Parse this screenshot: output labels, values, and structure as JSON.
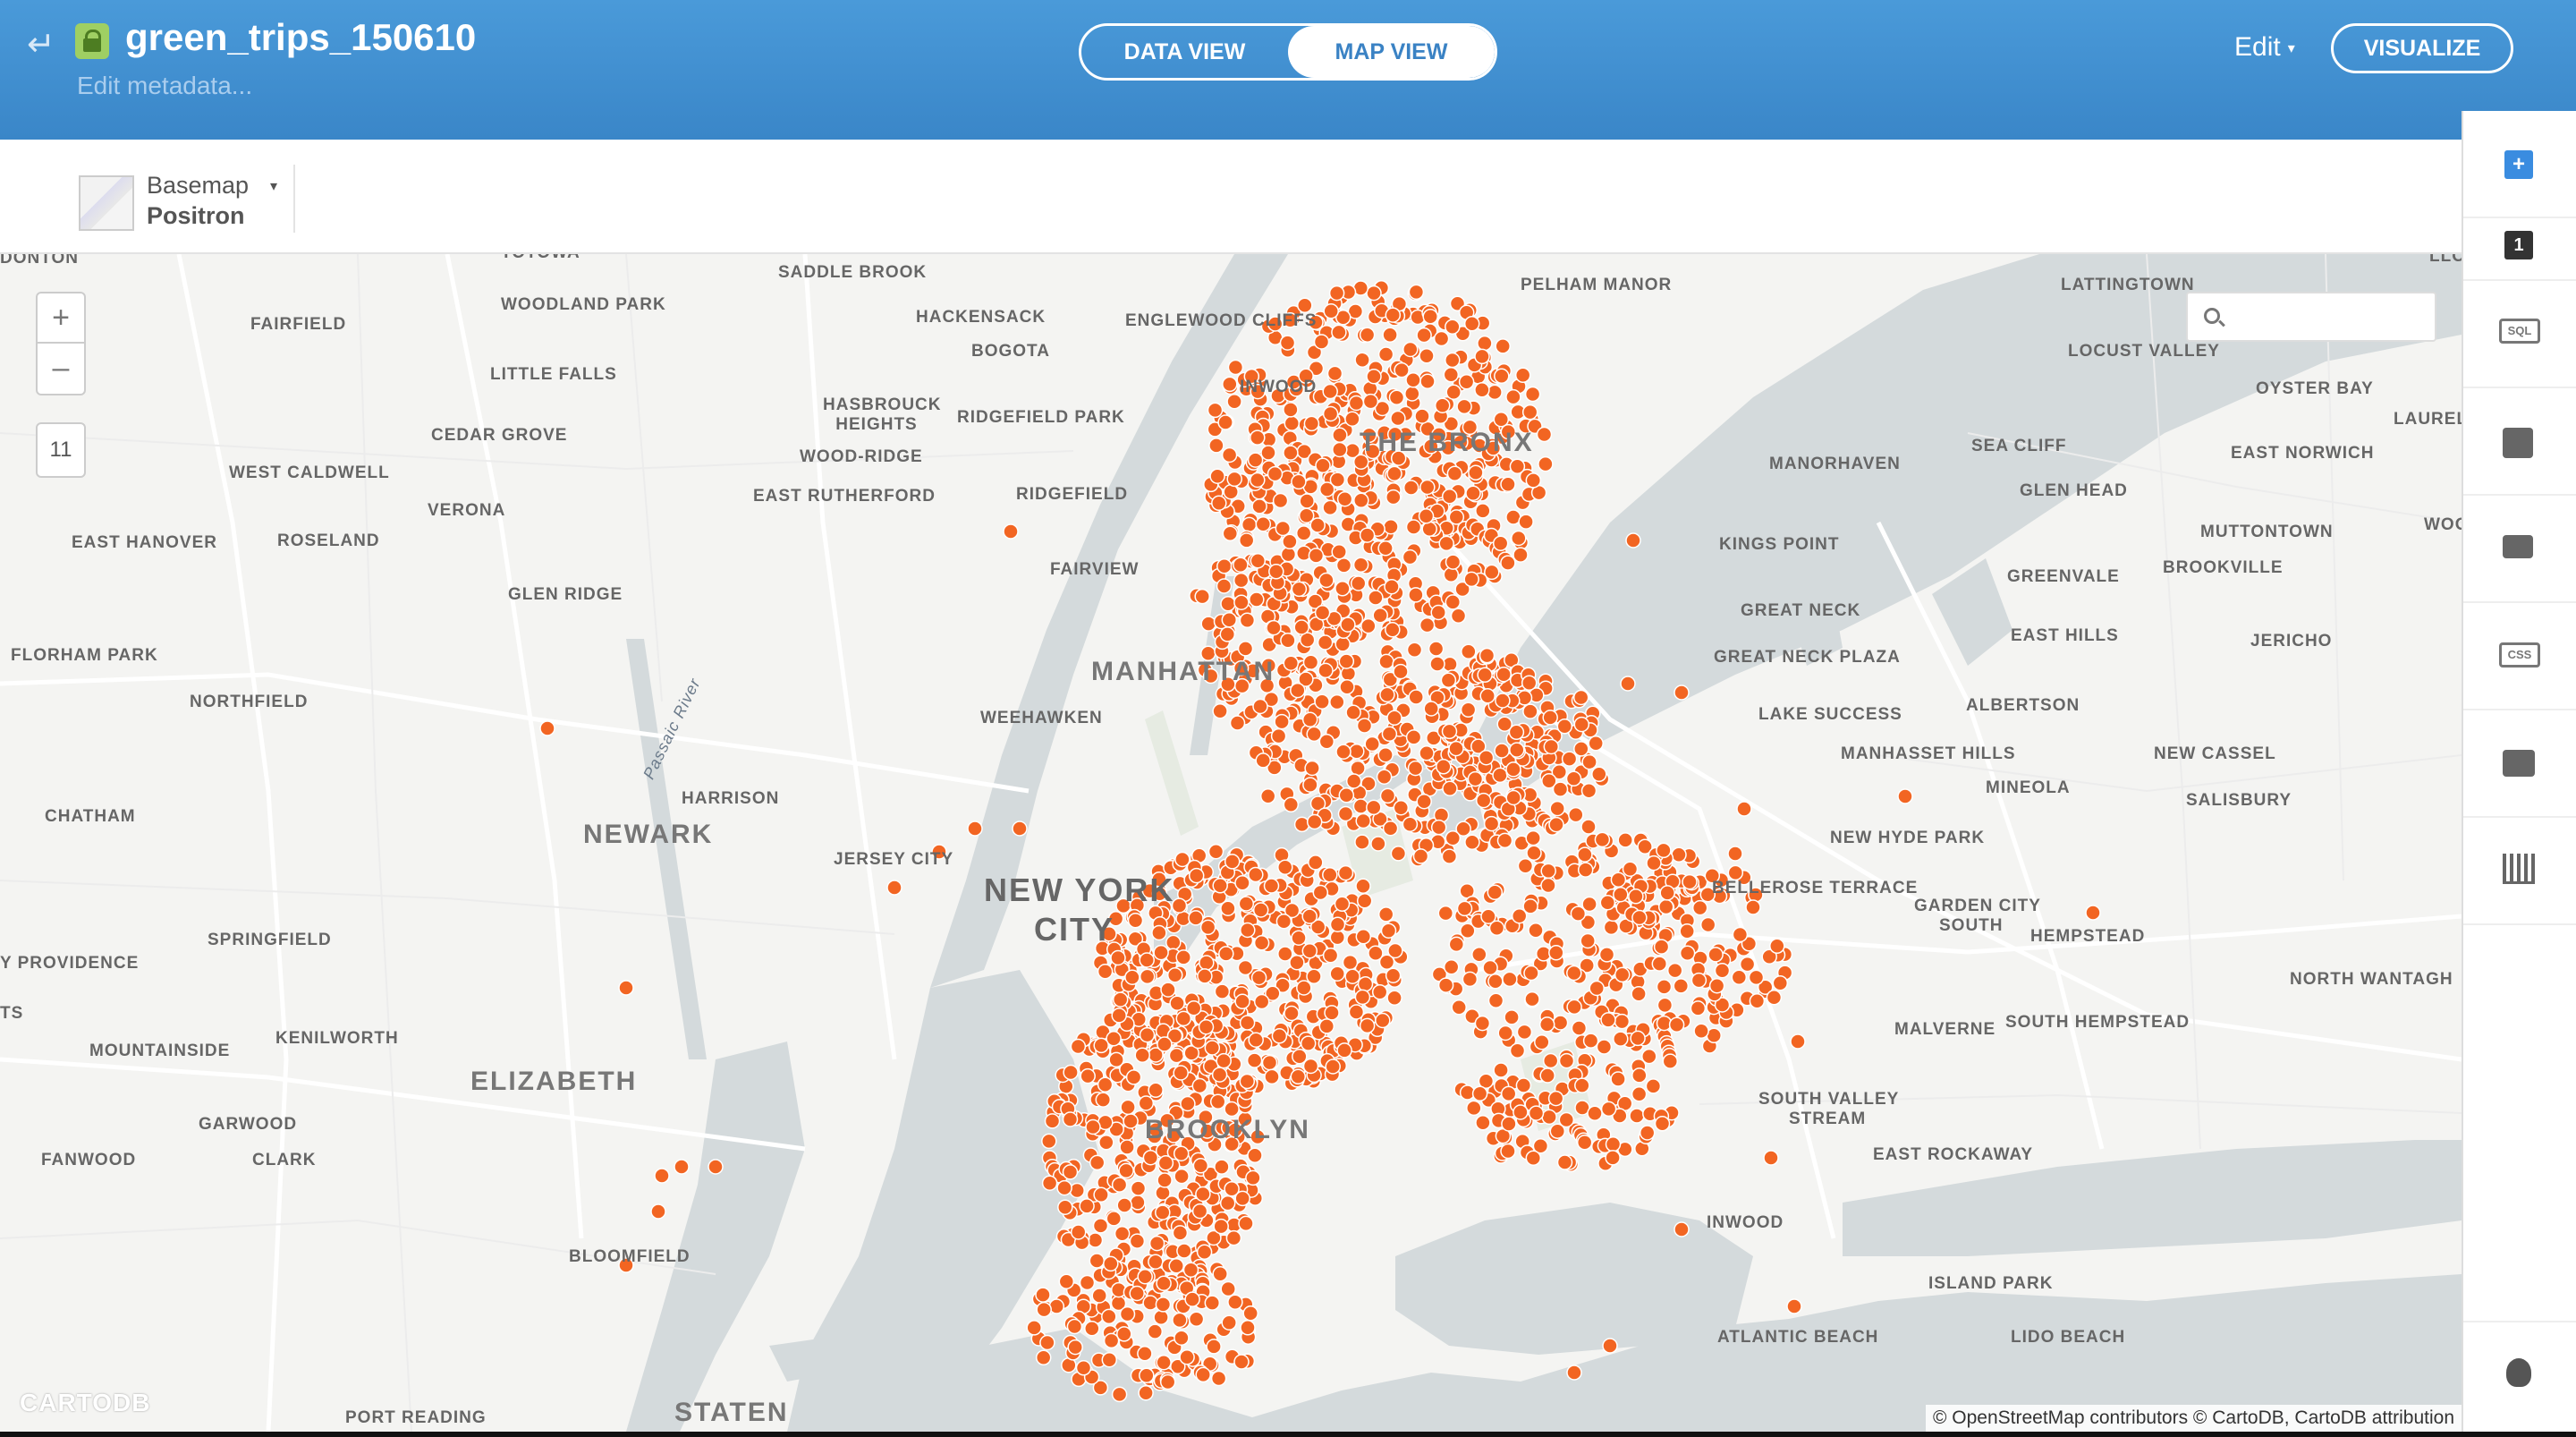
{
  "header": {
    "title": "green_trips_150610",
    "edit_metadata": "Edit metadata...",
    "tabs": [
      {
        "label": "DATA VIEW",
        "active": false
      },
      {
        "label": "MAP VIEW",
        "active": true
      }
    ],
    "edit_label": "Edit",
    "visualize_label": "VISUALIZE"
  },
  "toolbar": {
    "basemap_label": "Basemap",
    "basemap_name": "Positron"
  },
  "map": {
    "zoom_level": "11",
    "search_placeholder": "",
    "logo": "CARTODB",
    "attribution": "© OpenStreetMap contributors © CartoDB, CartoDB attribution",
    "point_color": "#f26522",
    "place_labels": [
      "DONTON",
      "TOTOWA",
      "SADDLE BROOK",
      "WOODLAND PARK",
      "FAIRFIELD",
      "HACKENSACK",
      "BOGOTA",
      "ENGLEWOOD CLIFFS",
      "PELHAM MANOR",
      "LATTINGTOWN",
      "LLO",
      "LITTLE FALLS",
      "INWOOD",
      "LOCUST VALLEY",
      "CEDAR GROVE",
      "HASBROUCK HEIGHTS",
      "RIDGEFIELD PARK",
      "THE BRONX",
      "OYSTER BAY",
      "WEST CALDWELL",
      "WOOD-RIDGE",
      "SEA CLIFF",
      "LAUREL",
      "EAST NORWICH",
      "MANORHAVEN",
      "VERONA",
      "EAST RUTHERFORD",
      "RIDGEFIELD",
      "GLEN HEAD",
      "EAST HANOVER",
      "ROSELAND",
      "KINGS POINT",
      "MUTTONTOWN",
      "WOO",
      "FAIRVIEW",
      "GREENVALE",
      "BROOKVILLE",
      "GLEN RIDGE",
      "GREAT NECK",
      "EAST HILLS",
      "JERICHO",
      "FLORHAM PARK",
      "MANHATTAN",
      "GREAT NECK PLAZA",
      "NORTHFIELD",
      "ALBERTSON",
      "WEEHAWKEN",
      "LAKE SUCCESS",
      "Passaic River",
      "MANHASSET HILLS",
      "NEW CASSEL",
      "HARRISON",
      "MINEOLA",
      "SALISBURY",
      "CHATHAM",
      "NEWARK",
      "NEW HYDE PARK",
      "JERSEY CITY",
      "NEW YORK",
      "CITY",
      "BELLEROSE TERRACE",
      "GARDEN CITY",
      "SOUTH",
      "SPRINGFIELD",
      "HEMPSTEAD",
      "Y PROVIDENCE",
      "NORTH WANTAGH",
      "TS",
      "KENILWORTH",
      "MALVERNE",
      "SOUTH HEMPSTEAD",
      "MOUNTAINSIDE",
      "ELIZABETH",
      "SOUTH VALLEY",
      "STREAM",
      "GARWOOD",
      "BROOKLYN",
      "EAST ROCKAWAY",
      "FANWOOD",
      "CLARK",
      "INWOOD",
      "BLOOMFIELD",
      "ISLAND PARK",
      "ATLANTIC BEACH",
      "LIDO BEACH",
      "PORT READING",
      "STATEN"
    ]
  },
  "right_panel": {
    "items": [
      {
        "icon": "add-layer-icon",
        "label": "+"
      },
      {
        "icon": "layer-number-icon",
        "label": "1"
      },
      {
        "icon": "sql-icon",
        "label": "SQL"
      },
      {
        "icon": "wizard-brush-icon",
        "label": ""
      },
      {
        "icon": "infowindow-icon",
        "label": ""
      },
      {
        "icon": "css-icon",
        "label": "CSS"
      },
      {
        "icon": "legend-icon",
        "label": ""
      },
      {
        "icon": "chart-icon",
        "label": ""
      },
      {
        "icon": "help-bulb-icon",
        "label": ""
      }
    ]
  }
}
